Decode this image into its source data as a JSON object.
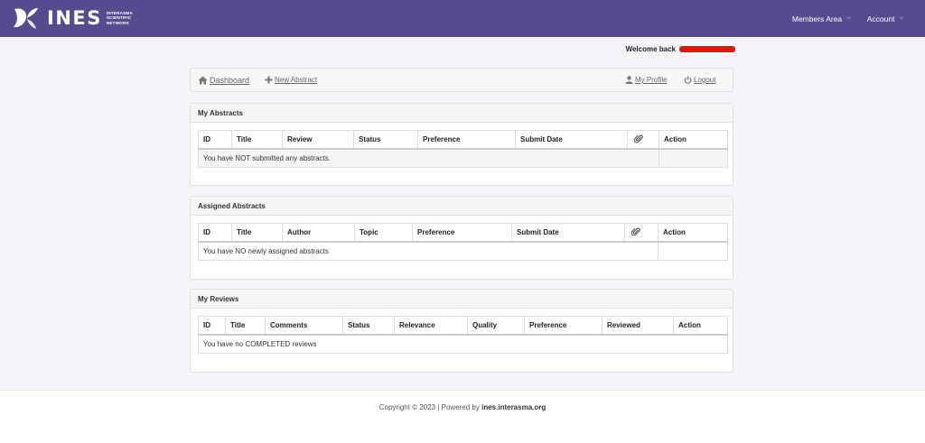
{
  "brand": {
    "name": "INES",
    "sub_line1": "INTERASMA",
    "sub_line2": "SCIENTIFIC",
    "sub_line3": "NETWORK"
  },
  "nav": {
    "members_area": "Members Area",
    "account": "Account"
  },
  "welcome": {
    "text": "Welcome back"
  },
  "toolbar": {
    "dashboard": "Dashboard",
    "new_abstract": "New Abstract",
    "my_profile": "My Profile",
    "logout": "Logout"
  },
  "my_abstracts": {
    "title": "My Abstracts",
    "columns": [
      "ID",
      "Title",
      "Review",
      "Status",
      "Preference",
      "Submit Date",
      "",
      "Action"
    ],
    "empty": "You have NOT submitted any abstracts."
  },
  "assigned_abstracts": {
    "title": "Assigned Abstracts",
    "columns": [
      "ID",
      "Title",
      "Author",
      "Topic",
      "Preference",
      "Submit Date",
      "",
      "Action"
    ],
    "empty": "You have NO newly assigned abstracts"
  },
  "my_reviews": {
    "title": "My Reviews",
    "columns": [
      "ID",
      "Title",
      "Comments",
      "Status",
      "Relevance",
      "Quality",
      "Preference",
      "Reviewed",
      "Action"
    ],
    "empty": "You have no COMPLETED reviews"
  },
  "footer": {
    "copyright": "Copyright © 2023 | Powered by ",
    "site": "ines.interasma.org"
  },
  "colors": {
    "navbar": "#574a8f",
    "background": "#f4f5fa",
    "redaction": "#ee1111"
  }
}
